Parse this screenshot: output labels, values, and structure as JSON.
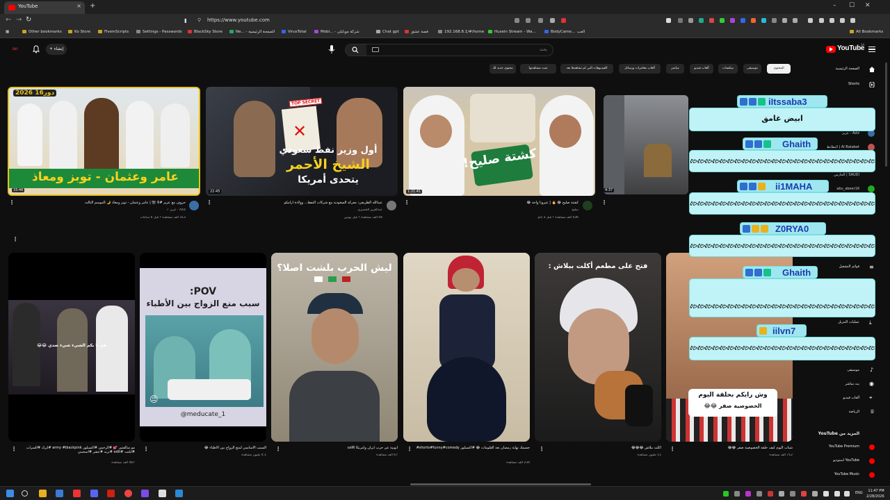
{
  "browser": {
    "tab_title": "YouTube",
    "tab_close": "×",
    "new_tab": "+",
    "url": "https://www.youtube.com",
    "badge": "19",
    "window_controls": [
      "–",
      "☐",
      "✕"
    ],
    "bookmarks": [
      "Other bookmarks",
      "Ko Store",
      "FivemScripts",
      "Settings - Passwords",
      "BlackSky Store",
      "Ne... - الصفحة الرئيسية",
      "VirusTotal",
      "Mobi... - شركة موبايلي",
      "Chat gpt",
      "قصة عشق",
      "192.168.8.1/#/home",
      "Husein Stream - Wa...",
      "BodyCame...",
      "العب"
    ],
    "all_bookmarks": "All Bookmarks"
  },
  "header": {
    "create_label": "إنشاء",
    "search_placeholder": "بحث",
    "logo_text": "YouTube",
    "region": "SA",
    "avatar_text": "BKY"
  },
  "chips": [
    "الكل",
    "المحتوى",
    "موسيقى",
    "ميكسات",
    "ألعاب فيديو",
    "مباشر",
    "ألعاب مغامرات ورسائل",
    "الفيديوهات التي لم تشاهدها بعد",
    "القنوات التي تم تحميلها مؤخرًا",
    "تمت مشاهدتها",
    "محتوى جديد لك"
  ],
  "sidebar": {
    "top": [
      {
        "label": "الصفحة الرئيسية"
      },
      {
        "label": "Shorts"
      }
    ],
    "subs": [
      {
        "label": "Aziz - عزيز"
      },
      {
        "label": "Al Batabet | البطابط"
      },
      {
        "label": "SAUDI | الحارس"
      },
      {
        "label": "abu_abeer16"
      }
    ],
    "you": [
      {
        "label": "أنت"
      },
      {
        "label": "سجل المشاهدة"
      },
      {
        "label": "قوائم التشغيل"
      },
      {
        "label": "عمليات التنزيل"
      }
    ],
    "explore": [
      {
        "label": "موسيقى"
      },
      {
        "label": "بث مباشر"
      },
      {
        "label": "ألعاب فيديو"
      },
      {
        "label": "الرياضة"
      }
    ],
    "more_title": "المزيد من YouTube",
    "more": [
      {
        "label": "YouTube Premium"
      },
      {
        "label": "YouTube استوديو"
      },
      {
        "label": "YouTube Music"
      }
    ]
  },
  "videos": [
    {
      "title": "حروف مع عزيز #6 🎬 | عامر وعثمان - توبز ومعاذ 🌙 الموسم الثالث",
      "channel": "Aziz - عزيز ✓",
      "meta": "313 ألف مشاهدة • قبل 6 ساعات",
      "duration": "33:46",
      "thumb_top": "دور16 2026",
      "thumb_bottom": "عامر وعثمان - توبز ومعاذ"
    },
    {
      "title": "عبدالله الظريفي: معركة السعودية مع شركات النفط... وولادة أرامكو",
      "channel": "عبدالعزيز الخضيري",
      "meta": "44 ألف مشاهدة • قبل يومين",
      "duration": "22:45",
      "thumb_top": "أول وزير نفط سعودي",
      "thumb_mid": "الشيخ الأحمر",
      "thumb_bottom": "يتحدى أمريكا",
      "stamp": "TOP SECRET"
    },
    {
      "title": "كشتة صليح 😂 🔥 | عيزونا واحد 😂",
      "channel": "صليح",
      "meta": "436 ألف مشاهدة • قبل 3 أيام",
      "duration": "1:21:41",
      "thumb_text": "كشتة صليح!"
    },
    {
      "title": "",
      "channel": "",
      "meta": "",
      "duration": "4:37"
    }
  ],
  "shorts": [
    {
      "title": "مو سالفتين 💕 #الرحمن #اكسبلور army #blackpink #ايرك #السراب #ايلنت #edit #ترند #عشر #اسحبني",
      "meta": "487 ألف مشاهدة",
      "overlay": "هم يا بكم الشيء شيء ضدي 😂😂"
    },
    {
      "title": "السبب الأساسي لمنع الزواج بين الأطباء 😂",
      "meta": "4.1 مليون مشاهدة",
      "overlay": "POV:",
      "overlay2": "سبب منع الزواج بين الأطباء",
      "tag": "@meducate_1"
    },
    {
      "title": "ايوبية عن حرب ايران وأمريكا usIR",
      "meta": "67 ألف مشاهدة",
      "overlay": "ليش الحرب بلشت اصلا؟"
    },
    {
      "title": "جسمك نهاية رمسان بعد القلومات 😂 #اكسبلور shorts#funny#comedy#",
      "meta": "234 ألف مشاهدة",
      "overlay": ""
    },
    {
      "title": "أكلت ببلاش 😂😂😂",
      "meta": "11 مليون مشاهدة",
      "overlay": "فتح على مطعم أكلت ببلاش :"
    },
    {
      "title": "شباب اليوم كيف حلقة الخصوصية صفر 😂😂",
      "meta": "712 ألف مشاهدة",
      "overlay": "وش رايكم بحلقة اليوم",
      "overlay2": "الخصوصية صفر 😂😂"
    }
  ],
  "chat": [
    {
      "name": "iItssaba3",
      "message": "ابيض غامق"
    },
    {
      "name": "Ghaith",
      "message": ""
    },
    {
      "name": "ii1MAHA",
      "message": ""
    },
    {
      "name": "Z0RYA0",
      "message": ""
    },
    {
      "name": "Ghaith",
      "message": ""
    },
    {
      "name": "iilvn7",
      "message": ""
    }
  ],
  "taskbar": {
    "lang": "ENG",
    "time": "11:47 PM",
    "date": "2/28/2026"
  },
  "colors": {
    "accent": "#ff0000",
    "chat_bg": "#bff3f7",
    "chat_name": "#1a3bb0",
    "page_bg": "#0f0f0f"
  }
}
